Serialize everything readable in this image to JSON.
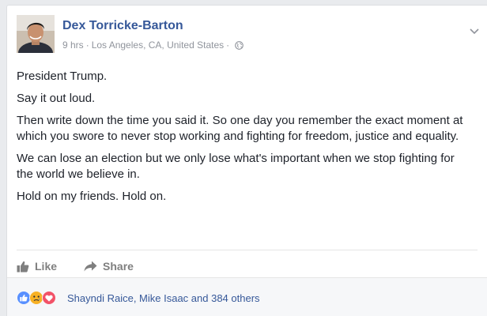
{
  "post": {
    "author": "Dex Torricke-Barton",
    "time": "9 hrs",
    "separator": "·",
    "location": "Los Angeles, CA, United States",
    "separator2": "·",
    "audience_icon": "globe-icon",
    "menu_icon": "chevron-down-icon",
    "paragraphs": [
      "President Trump.",
      "Say it out loud.",
      "Then write down the time you said it. So one day you remember the exact moment at which you swore to never stop working and fighting for freedom, justice and equality.",
      "We can lose an election but we only lose what's important when we stop fighting for the world we believe in.",
      "Hold on my friends. Hold on."
    ]
  },
  "actions": {
    "like_label": "Like",
    "like_icon": "thumbs-up-icon",
    "share_label": "Share",
    "share_icon": "share-arrow-icon"
  },
  "reactions": {
    "icons": [
      "like-reaction-icon",
      "sad-reaction-icon",
      "love-reaction-icon"
    ],
    "summary": "Shayndi Raice, Mike Isaac and 384 others"
  },
  "colors": {
    "link_blue": "#365899",
    "like_blue": "#5890ff",
    "sad_yellow": "#f7b125",
    "love_red": "#f25268",
    "muted_gray": "#90949c"
  }
}
